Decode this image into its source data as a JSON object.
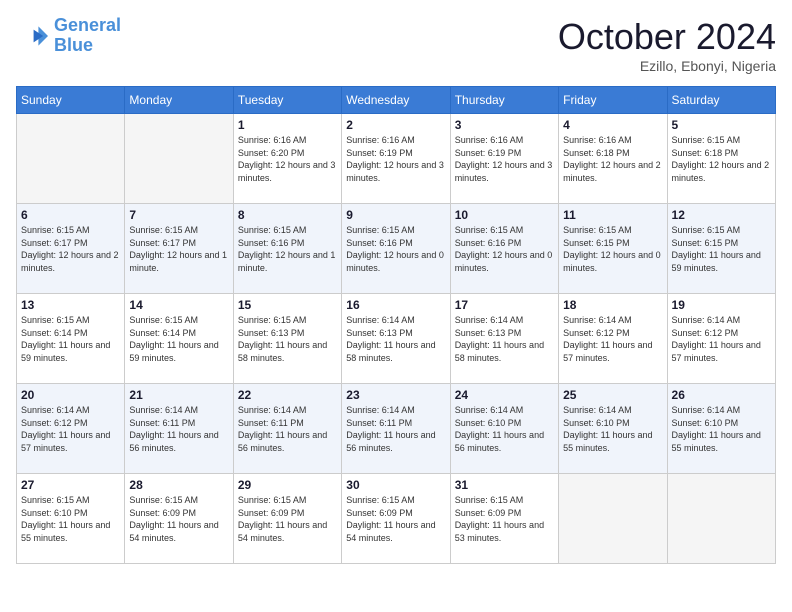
{
  "header": {
    "logo_line1": "General",
    "logo_line2": "Blue",
    "month": "October 2024",
    "location": "Ezillo, Ebonyi, Nigeria"
  },
  "days_of_week": [
    "Sunday",
    "Monday",
    "Tuesday",
    "Wednesday",
    "Thursday",
    "Friday",
    "Saturday"
  ],
  "weeks": [
    [
      {
        "day": "",
        "info": ""
      },
      {
        "day": "",
        "info": ""
      },
      {
        "day": "1",
        "info": "Sunrise: 6:16 AM\nSunset: 6:20 PM\nDaylight: 12 hours and 3 minutes."
      },
      {
        "day": "2",
        "info": "Sunrise: 6:16 AM\nSunset: 6:19 PM\nDaylight: 12 hours and 3 minutes."
      },
      {
        "day": "3",
        "info": "Sunrise: 6:16 AM\nSunset: 6:19 PM\nDaylight: 12 hours and 3 minutes."
      },
      {
        "day": "4",
        "info": "Sunrise: 6:16 AM\nSunset: 6:18 PM\nDaylight: 12 hours and 2 minutes."
      },
      {
        "day": "5",
        "info": "Sunrise: 6:15 AM\nSunset: 6:18 PM\nDaylight: 12 hours and 2 minutes."
      }
    ],
    [
      {
        "day": "6",
        "info": "Sunrise: 6:15 AM\nSunset: 6:17 PM\nDaylight: 12 hours and 2 minutes."
      },
      {
        "day": "7",
        "info": "Sunrise: 6:15 AM\nSunset: 6:17 PM\nDaylight: 12 hours and 1 minute."
      },
      {
        "day": "8",
        "info": "Sunrise: 6:15 AM\nSunset: 6:16 PM\nDaylight: 12 hours and 1 minute."
      },
      {
        "day": "9",
        "info": "Sunrise: 6:15 AM\nSunset: 6:16 PM\nDaylight: 12 hours and 0 minutes."
      },
      {
        "day": "10",
        "info": "Sunrise: 6:15 AM\nSunset: 6:16 PM\nDaylight: 12 hours and 0 minutes."
      },
      {
        "day": "11",
        "info": "Sunrise: 6:15 AM\nSunset: 6:15 PM\nDaylight: 12 hours and 0 minutes."
      },
      {
        "day": "12",
        "info": "Sunrise: 6:15 AM\nSunset: 6:15 PM\nDaylight: 11 hours and 59 minutes."
      }
    ],
    [
      {
        "day": "13",
        "info": "Sunrise: 6:15 AM\nSunset: 6:14 PM\nDaylight: 11 hours and 59 minutes."
      },
      {
        "day": "14",
        "info": "Sunrise: 6:15 AM\nSunset: 6:14 PM\nDaylight: 11 hours and 59 minutes."
      },
      {
        "day": "15",
        "info": "Sunrise: 6:15 AM\nSunset: 6:13 PM\nDaylight: 11 hours and 58 minutes."
      },
      {
        "day": "16",
        "info": "Sunrise: 6:14 AM\nSunset: 6:13 PM\nDaylight: 11 hours and 58 minutes."
      },
      {
        "day": "17",
        "info": "Sunrise: 6:14 AM\nSunset: 6:13 PM\nDaylight: 11 hours and 58 minutes."
      },
      {
        "day": "18",
        "info": "Sunrise: 6:14 AM\nSunset: 6:12 PM\nDaylight: 11 hours and 57 minutes."
      },
      {
        "day": "19",
        "info": "Sunrise: 6:14 AM\nSunset: 6:12 PM\nDaylight: 11 hours and 57 minutes."
      }
    ],
    [
      {
        "day": "20",
        "info": "Sunrise: 6:14 AM\nSunset: 6:12 PM\nDaylight: 11 hours and 57 minutes."
      },
      {
        "day": "21",
        "info": "Sunrise: 6:14 AM\nSunset: 6:11 PM\nDaylight: 11 hours and 56 minutes."
      },
      {
        "day": "22",
        "info": "Sunrise: 6:14 AM\nSunset: 6:11 PM\nDaylight: 11 hours and 56 minutes."
      },
      {
        "day": "23",
        "info": "Sunrise: 6:14 AM\nSunset: 6:11 PM\nDaylight: 11 hours and 56 minutes."
      },
      {
        "day": "24",
        "info": "Sunrise: 6:14 AM\nSunset: 6:10 PM\nDaylight: 11 hours and 56 minutes."
      },
      {
        "day": "25",
        "info": "Sunrise: 6:14 AM\nSunset: 6:10 PM\nDaylight: 11 hours and 55 minutes."
      },
      {
        "day": "26",
        "info": "Sunrise: 6:14 AM\nSunset: 6:10 PM\nDaylight: 11 hours and 55 minutes."
      }
    ],
    [
      {
        "day": "27",
        "info": "Sunrise: 6:15 AM\nSunset: 6:10 PM\nDaylight: 11 hours and 55 minutes."
      },
      {
        "day": "28",
        "info": "Sunrise: 6:15 AM\nSunset: 6:09 PM\nDaylight: 11 hours and 54 minutes."
      },
      {
        "day": "29",
        "info": "Sunrise: 6:15 AM\nSunset: 6:09 PM\nDaylight: 11 hours and 54 minutes."
      },
      {
        "day": "30",
        "info": "Sunrise: 6:15 AM\nSunset: 6:09 PM\nDaylight: 11 hours and 54 minutes."
      },
      {
        "day": "31",
        "info": "Sunrise: 6:15 AM\nSunset: 6:09 PM\nDaylight: 11 hours and 53 minutes."
      },
      {
        "day": "",
        "info": ""
      },
      {
        "day": "",
        "info": ""
      }
    ]
  ]
}
